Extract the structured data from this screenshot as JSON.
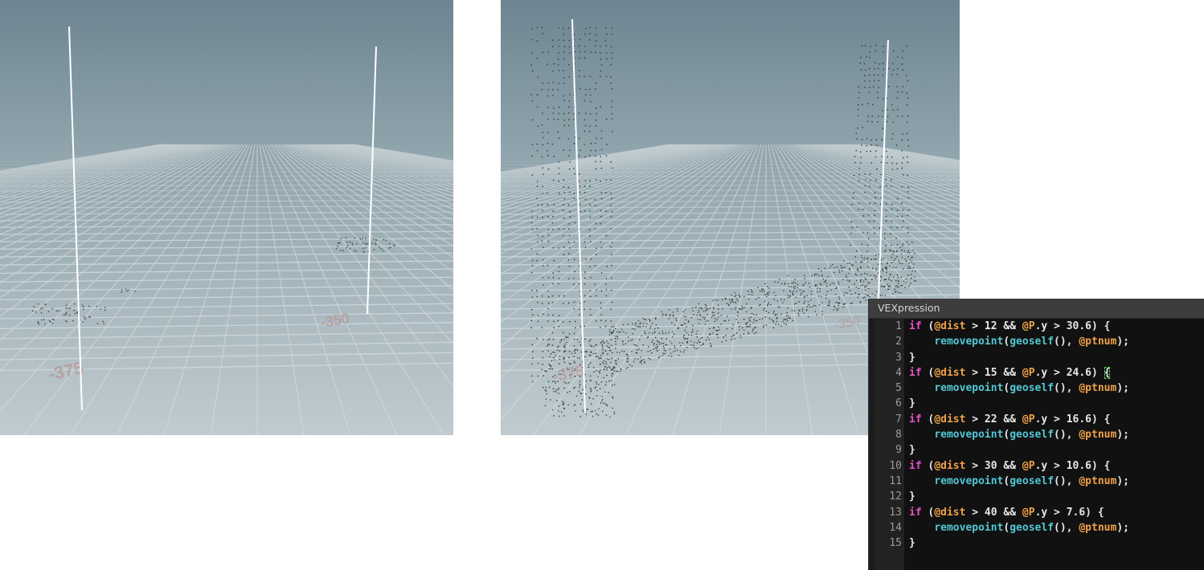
{
  "left_viewport": {
    "grid_labels": [
      "-375",
      "-350"
    ]
  },
  "right_viewport": {
    "grid_labels": [
      "-375",
      "-350"
    ]
  },
  "vex_panel": {
    "title": "VEXpression",
    "code_lines": [
      {
        "n": "1",
        "text": "if (@dist > 12 && @P.y > 30.6) {"
      },
      {
        "n": "2",
        "text": "    removepoint(geoself(), @ptnum);"
      },
      {
        "n": "3",
        "text": "}"
      },
      {
        "n": "4",
        "text": "if (@dist > 15 && @P.y > 24.6) {"
      },
      {
        "n": "5",
        "text": "    removepoint(geoself(), @ptnum);"
      },
      {
        "n": "6",
        "text": "}"
      },
      {
        "n": "7",
        "text": "if (@dist > 22 && @P.y > 16.6) {"
      },
      {
        "n": "8",
        "text": "    removepoint(geoself(), @ptnum);"
      },
      {
        "n": "9",
        "text": "}"
      },
      {
        "n": "10",
        "text": "if (@dist > 30 && @P.y > 10.6) {"
      },
      {
        "n": "11",
        "text": "    removepoint(geoself(), @ptnum);"
      },
      {
        "n": "12",
        "text": "}"
      },
      {
        "n": "13",
        "text": "if (@dist > 40 && @P.y > 7.6) {"
      },
      {
        "n": "14",
        "text": "    removepoint(geoself(), @ptnum);"
      },
      {
        "n": "15",
        "text": "}"
      }
    ],
    "colors": {
      "keyword": "#e552c9",
      "attribute": "#f0a24a",
      "function": "#52c7d4",
      "text": "#e6e6e6"
    }
  }
}
